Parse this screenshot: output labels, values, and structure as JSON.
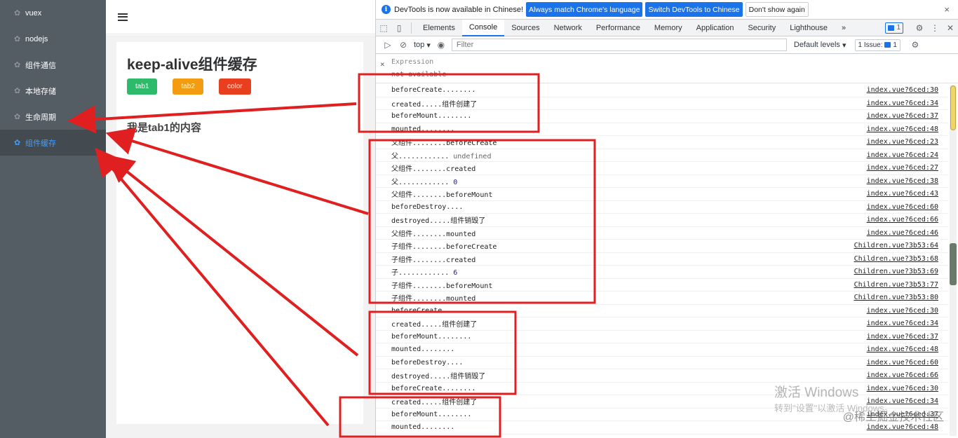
{
  "sidebar": {
    "items": [
      {
        "label": "vuex",
        "icon": "gear-icon"
      },
      {
        "label": "nodejs",
        "icon": "gear-icon"
      },
      {
        "label": "组件通信",
        "icon": "gear-icon"
      },
      {
        "label": "本地存储",
        "icon": "gear-icon"
      },
      {
        "label": "生命周期",
        "icon": "gear-icon"
      },
      {
        "label": "组件缓存",
        "icon": "gear-icon",
        "active": true
      }
    ],
    "active_color": "#409eff"
  },
  "app": {
    "title": "keep-alive组件缓存",
    "tabs": [
      {
        "label": "tab1",
        "color": "#2dbb6b"
      },
      {
        "label": "tab2",
        "color": "#f39c12"
      },
      {
        "label": "color",
        "color": "#e8401f"
      }
    ],
    "content": "我是tab1的内容"
  },
  "devtools": {
    "banner": {
      "text": "DevTools is now available in Chinese!",
      "btn_match": "Always match Chrome's language",
      "btn_switch": "Switch DevTools to Chinese",
      "btn_dismiss": "Don't show again",
      "close": "×"
    },
    "tabs": [
      "Elements",
      "Console",
      "Sources",
      "Network",
      "Performance",
      "Memory",
      "Application",
      "Security",
      "Lighthouse"
    ],
    "more": "»",
    "message_count": "1",
    "toolbar": {
      "context": "top",
      "filter_placeholder": "Filter",
      "levels": "Default levels",
      "issues": "1 Issue:",
      "issues_count": "1"
    },
    "expression": {
      "label": "Expression",
      "value": "not available"
    },
    "logs": [
      {
        "msg": "beforeCreate........",
        "src": "index.vue?6ced:30"
      },
      {
        "msg": "created.....组件创建了",
        "src": "index.vue?6ced:34"
      },
      {
        "msg": "beforeMount........",
        "src": "index.vue?6ced:37"
      },
      {
        "msg": "mounted........",
        "src": "index.vue?6ced:48"
      },
      {
        "msg": "父组件........beforeCreate",
        "src": "index.vue?6ced:23"
      },
      {
        "msg": "父............ ",
        "tail": "undefined",
        "tail_type": "undef",
        "src": "index.vue?6ced:24"
      },
      {
        "msg": "父组件........created",
        "src": "index.vue?6ced:27"
      },
      {
        "msg": "父............ ",
        "tail": "0",
        "tail_type": "num",
        "src": "index.vue?6ced:38"
      },
      {
        "msg": "父组件........beforeMount",
        "src": "index.vue?6ced:43"
      },
      {
        "msg": "beforeDestroy....",
        "src": "index.vue?6ced:60"
      },
      {
        "msg": "destroyed.....组件销毁了",
        "src": "index.vue?6ced:66"
      },
      {
        "msg": "父组件........mounted",
        "src": "index.vue?6ced:46"
      },
      {
        "msg": "子组件........beforeCreate",
        "src": "Children.vue?3b53:64"
      },
      {
        "msg": "子组件........created",
        "src": "Children.vue?3b53:68"
      },
      {
        "msg": "子............ ",
        "tail": "6",
        "tail_type": "num",
        "src": "Children.vue?3b53:69"
      },
      {
        "msg": "子组件........beforeMount",
        "src": "Children.vue?3b53:77"
      },
      {
        "msg": "子组件........mounted",
        "src": "Children.vue?3b53:80"
      },
      {
        "msg": "beforeCreate........",
        "src": "index.vue?6ced:30"
      },
      {
        "msg": "created.....组件创建了",
        "src": "index.vue?6ced:34"
      },
      {
        "msg": "beforeMount........",
        "src": "index.vue?6ced:37"
      },
      {
        "msg": "mounted........",
        "src": "index.vue?6ced:48"
      },
      {
        "msg": "beforeDestroy....",
        "src": "index.vue?6ced:60"
      },
      {
        "msg": "destroyed.....组件销毁了",
        "src": "index.vue?6ced:66"
      },
      {
        "msg": "beforeCreate........",
        "src": "index.vue?6ced:30"
      },
      {
        "msg": "created.....组件创建了",
        "src": "index.vue?6ced:34"
      },
      {
        "msg": "beforeMount........",
        "src": "index.vue?6ced:37"
      },
      {
        "msg": "mounted........",
        "src": "index.vue?6ced:48"
      }
    ]
  },
  "watermark": {
    "title": "激活 Windows",
    "subtitle": "转到\"设置\"以激活 Windows。",
    "credit": "@稀土掘金技术社区"
  },
  "annotation_color": "#e02020"
}
